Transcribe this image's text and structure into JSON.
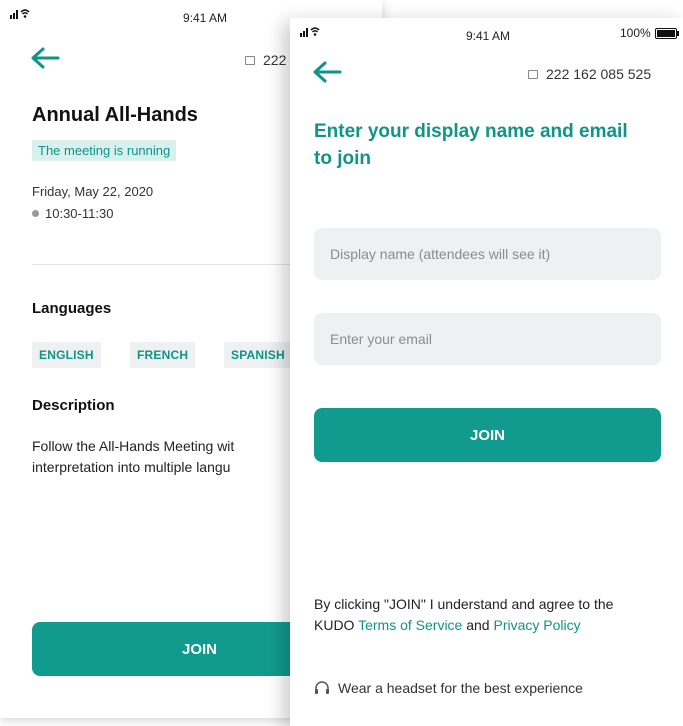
{
  "colors": {
    "accent": "#119b8f",
    "accent_text": "#0e9488",
    "badge_bg": "#d9f1ee",
    "field_bg": "#eef0f1"
  },
  "back_screen": {
    "status_bar": {
      "time": "9:41 AM",
      "battery": "100%"
    },
    "meeting_id_partial": "222",
    "title": "Annual All-Hands",
    "status_badge": "The meeting is running",
    "date": "Friday, May 22, 2020",
    "time_range": "10:30-11:30",
    "languages_heading": "Languages",
    "languages": [
      "ENGLISH",
      "FRENCH",
      "SPANISH"
    ],
    "description_heading": "Description",
    "description_lines": [
      "Follow the All-Hands Meeting wit",
      "interpretation into multiple langu"
    ],
    "join_label": "JOIN",
    "icons": {
      "back": "arrow-left-icon",
      "clock": "clock-icon",
      "id": "id-card-icon"
    }
  },
  "front_screen": {
    "status_bar": {
      "time": "9:41 AM",
      "battery": "100%"
    },
    "meeting_id": "222 162 085 525",
    "heading": "Enter your display name and email to join",
    "display_name_placeholder": "Display name (attendees will see it)",
    "email_placeholder": "Enter your email",
    "join_label": "JOIN",
    "legal": {
      "prefix": "By clicking \"JOIN\" I understand and agree to the KUDO ",
      "terms_link": "Terms of Service",
      "middle": " and ",
      "privacy_link": "Privacy Policy"
    },
    "headset_tip": "Wear a headset for the best experience",
    "icons": {
      "back": "arrow-left-icon",
      "id": "id-card-icon",
      "headset": "headset-icon"
    }
  }
}
